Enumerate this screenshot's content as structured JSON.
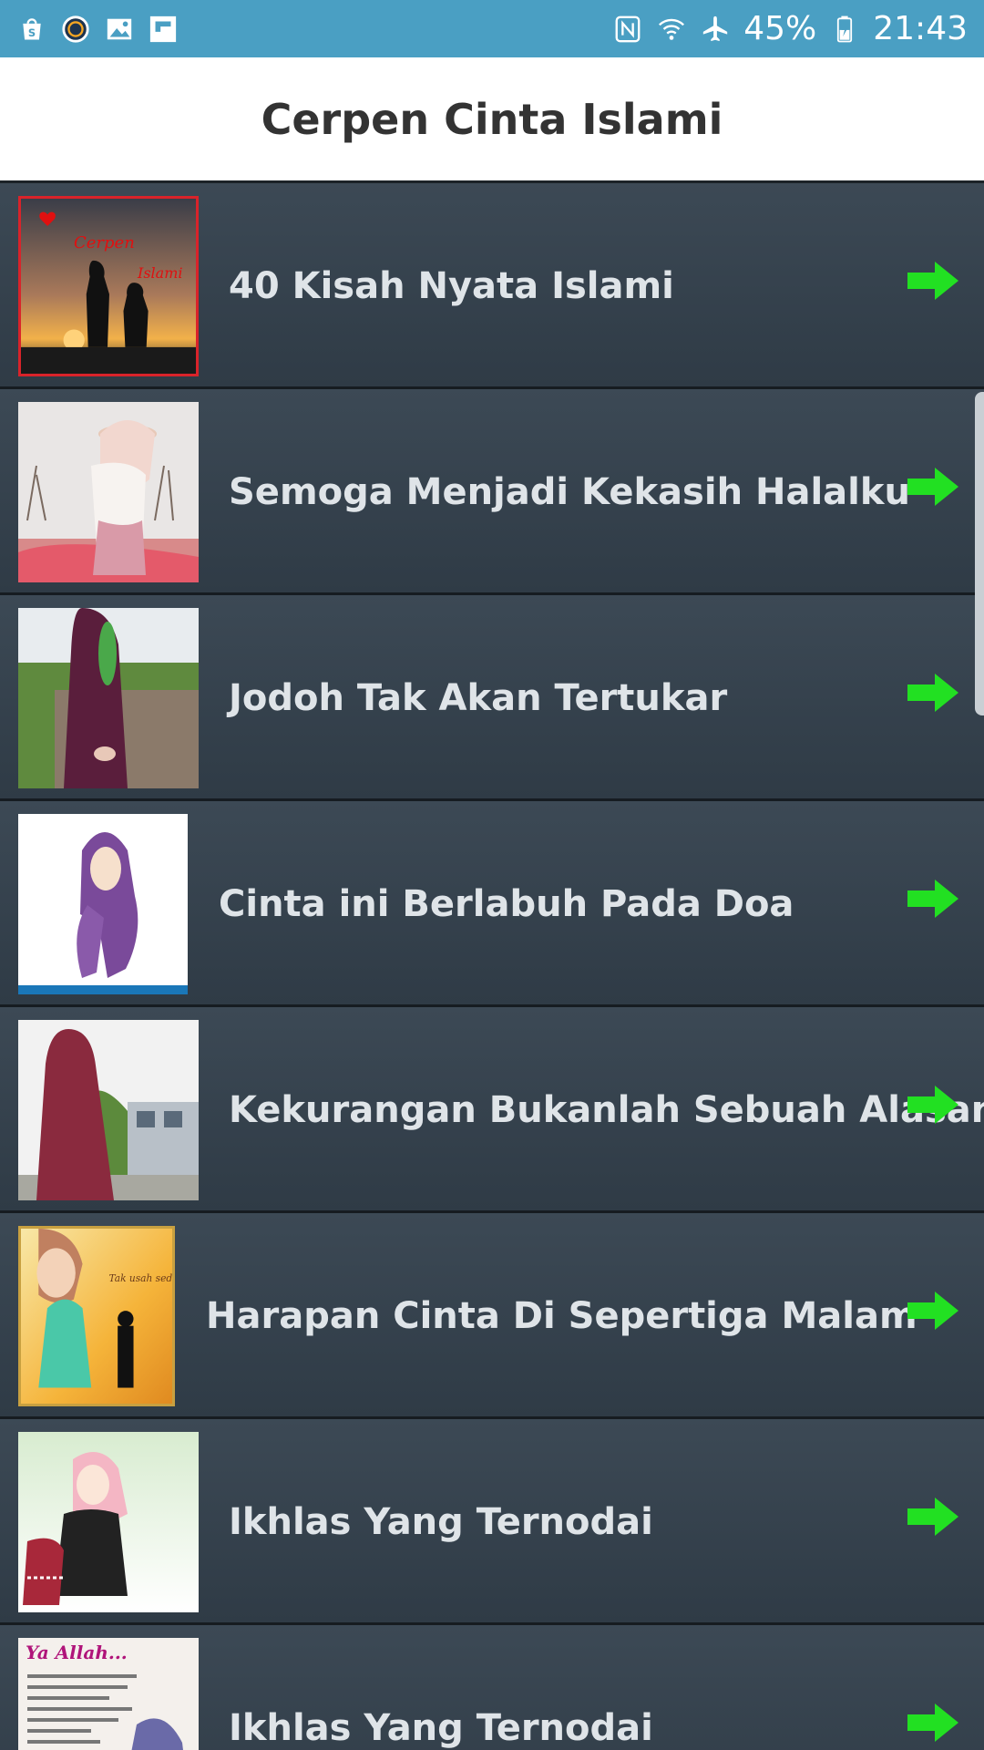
{
  "status_bar": {
    "left_icons": [
      "shopping-bag-icon",
      "s-logo-icon",
      "gallery-icon",
      "flipboard-icon"
    ],
    "right_icons": [
      "nfc-icon",
      "wifi-icon",
      "airplane-mode-icon",
      "battery-charging-icon"
    ],
    "battery": "45%",
    "time": "21:43"
  },
  "app_bar": {
    "title": "Cerpen Cinta Islami"
  },
  "list": {
    "items": [
      {
        "label": "40 Kisah Nyata Islami",
        "thumb_text_1": "Cerpen",
        "thumb_text_2": "Islami"
      },
      {
        "label": "Semoga Menjadi Kekasih Halalku"
      },
      {
        "label": "Jodoh Tak Akan Tertukar"
      },
      {
        "label": "Cinta ini Berlabuh Pada Doa"
      },
      {
        "label": "Kekurangan Bukanlah Sebuah Alasan"
      },
      {
        "label": "Harapan Cinta Di Sepertiga Malam"
      },
      {
        "label": "Ikhlas Yang Ternodai"
      },
      {
        "label": "Ikhlas Yang Ternodai",
        "thumb_text_1": "Ya Allah..."
      }
    ]
  },
  "colors": {
    "status_bar": "#4a9fc3",
    "row_bg": "#34414d",
    "arrow": "#22e022",
    "label": "#dfe4e8"
  }
}
